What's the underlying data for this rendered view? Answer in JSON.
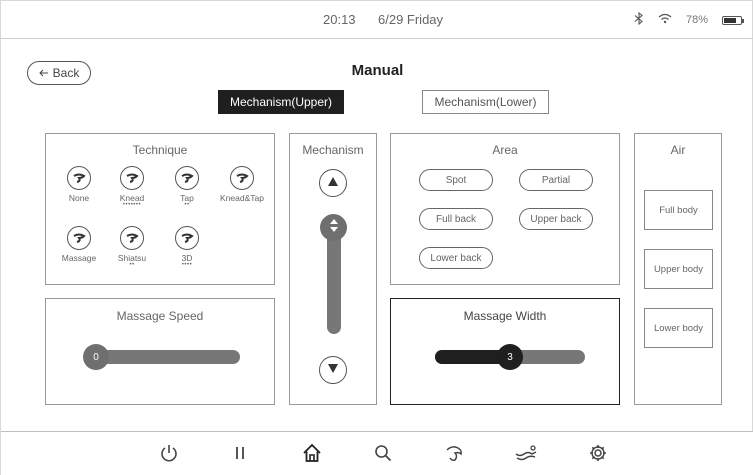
{
  "status": {
    "time": "20:13",
    "date": "6/29 Friday",
    "battery_label": "78%",
    "battery_level": 0.78
  },
  "header": {
    "back_label": "Back",
    "title": "Manual"
  },
  "mechanism_tabs": [
    {
      "label": "Mechanism(Upper)",
      "selected": true
    },
    {
      "label": "Mechanism(Lower)",
      "selected": false
    }
  ],
  "technique": {
    "title": "Technique",
    "items": [
      {
        "label": "None",
        "dots": ""
      },
      {
        "label": "Knead",
        "dots": "•••••••"
      },
      {
        "label": "Tap",
        "dots": "••"
      },
      {
        "label": "Knead&Tap",
        "dots": ""
      },
      {
        "label": "Massage",
        "dots": ""
      },
      {
        "label": "Shiatsu",
        "dots": "••"
      },
      {
        "label": "3D",
        "dots": "••••"
      }
    ]
  },
  "massage_speed": {
    "title": "Massage Speed",
    "value": "0",
    "level": 0
  },
  "mechanism": {
    "title": "Mechanism"
  },
  "area": {
    "title": "Area",
    "buttons": [
      "Spot",
      "Partial",
      "Full back",
      "Upper back",
      "Lower back"
    ]
  },
  "massage_width": {
    "title": "Massage Width",
    "value": "3",
    "level": 0.5
  },
  "air": {
    "title": "Air",
    "buttons": [
      "Full body",
      "Upper body",
      "Lower body"
    ]
  },
  "bottom_nav": [
    "power-icon",
    "pause-icon",
    "home-icon",
    "search-icon",
    "massage-hand-icon",
    "recline-icon",
    "settings-icon"
  ],
  "colors": {
    "accent_dark": "#1f1f1f",
    "knob_gray": "#6f6f6f",
    "panel_border": "#999999"
  }
}
